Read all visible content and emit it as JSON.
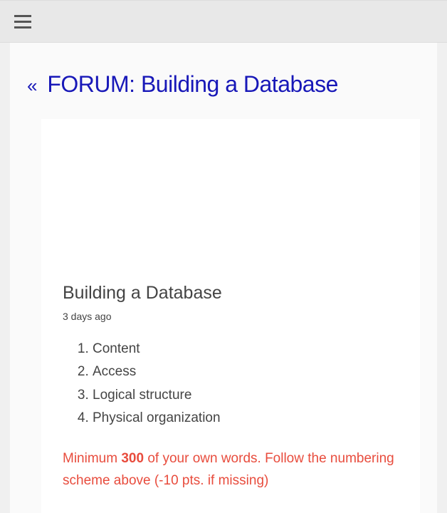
{
  "header": {
    "forum_prefix": "«",
    "forum_label": "FORUM:",
    "forum_topic": "Building a Database"
  },
  "post": {
    "title": "Building a Database",
    "timestamp": "3 days ago",
    "items": [
      "Content",
      "Access",
      "Logical structure",
      "Physical organization"
    ],
    "note_pre": "Minimum ",
    "note_bold": "300",
    "note_post": " of your own words. Follow the num­bering scheme above (-10 pts. if missing)"
  }
}
